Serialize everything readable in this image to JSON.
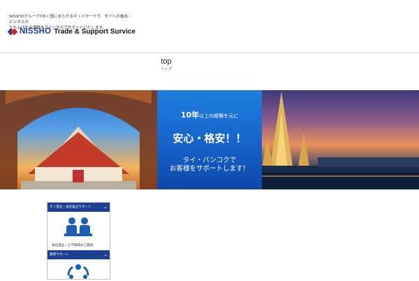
{
  "header": {
    "tagline_line1": "NISSHOグループの6ヶ国にまたがるネットワークで、タイへの進出・ビジネスの",
    "tagline_line2": "立ち上げから運営までトータルでサポートいたします。",
    "logo_name": "NISSHO",
    "logo_subtitle": "Trade & Support Survice"
  },
  "nav": {
    "label": "top",
    "sublabel": "トップ"
  },
  "banner": {
    "line1_strong": "10年",
    "line1_rest": "以上の経験を元に",
    "line2": "安心・格安！！",
    "line3a": "タイ・バンコクで",
    "line3b": "お客様をサポートします！"
  },
  "sidebar": {
    "items": [
      {
        "label": "タイ進出・会社設立サポート"
      },
      {
        "label": "会社設立・ビザ取得のご相談"
      },
      {
        "label": "業務サポート"
      }
    ]
  },
  "colors": {
    "brand_navy": "#1a3f93",
    "brand_red": "#d8262f",
    "banner_blue": "#1560c7"
  }
}
